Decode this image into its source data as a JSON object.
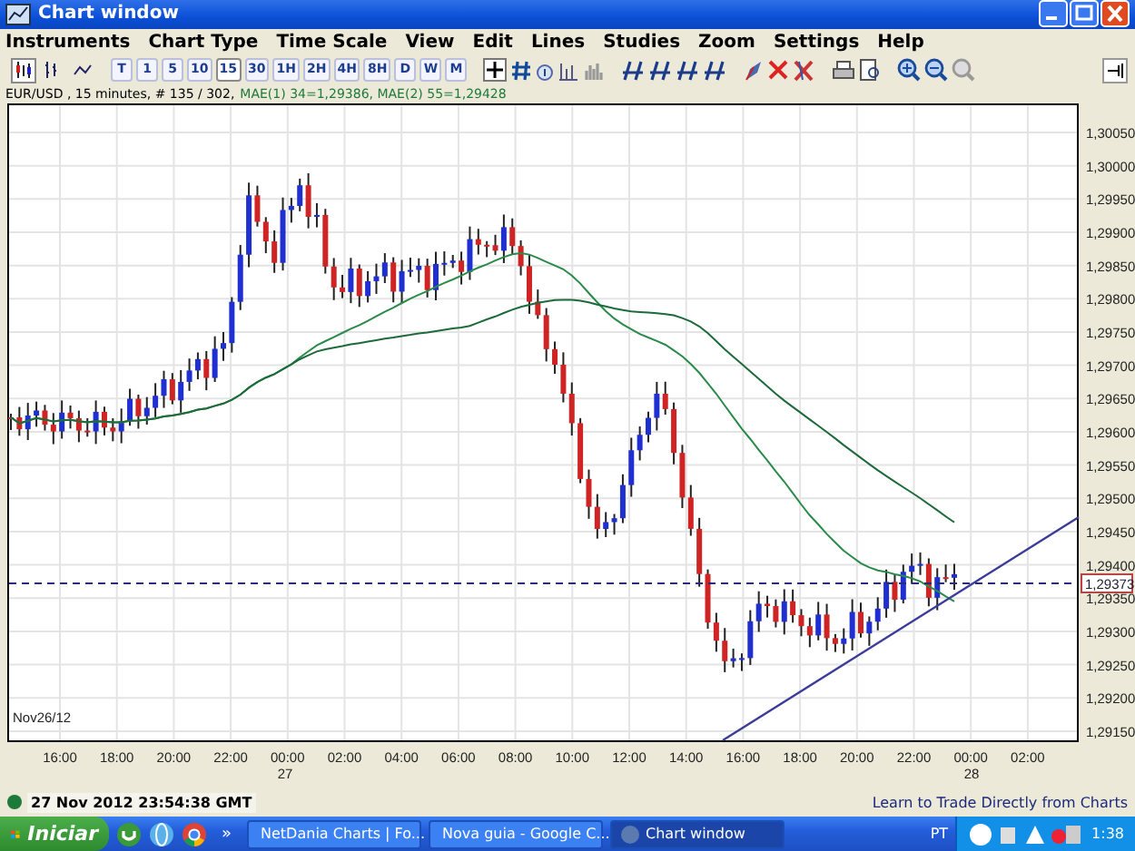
{
  "window": {
    "title": "Chart window"
  },
  "menu": [
    "Instruments",
    "Chart Type",
    "Time Scale",
    "View",
    "Edit",
    "Lines",
    "Studies",
    "Zoom",
    "Settings",
    "Help"
  ],
  "chart_types": [
    {
      "selected": true
    },
    {
      "selected": false
    },
    {
      "selected": false
    }
  ],
  "timeframes": [
    {
      "label": "T",
      "selected": false
    },
    {
      "label": "1",
      "selected": false
    },
    {
      "label": "5",
      "selected": false
    },
    {
      "label": "10",
      "selected": false
    },
    {
      "label": "15",
      "selected": true
    },
    {
      "label": "30",
      "selected": false
    },
    {
      "label": "1H",
      "selected": false
    },
    {
      "label": "2H",
      "selected": false
    },
    {
      "label": "4H",
      "selected": false
    },
    {
      "label": "8H",
      "selected": false
    },
    {
      "label": "D",
      "selected": false
    },
    {
      "label": "W",
      "selected": false
    },
    {
      "label": "M",
      "selected": false
    }
  ],
  "info": {
    "symbol": "EUR/USD , 15 minutes, # 135 / 302,",
    "indicators": "MAE(1) 34=1,29386, MAE(2) 55=1,29428"
  },
  "chart": {
    "y_labels": [
      "1,30050",
      "1,30000",
      "1,29950",
      "1,29900",
      "1,29850",
      "1,29800",
      "1,29750",
      "1,29700",
      "1,29650",
      "1,29600",
      "1,29550",
      "1,29500",
      "1,29450",
      "1,29400",
      "1,29350",
      "1,29300",
      "1,29250",
      "1,29200",
      "1,29150"
    ],
    "x_labels": [
      "16:00",
      "18:00",
      "20:00",
      "22:00",
      "00:00",
      "02:00",
      "04:00",
      "06:00",
      "08:00",
      "10:00",
      "12:00",
      "14:00",
      "16:00",
      "18:00",
      "20:00",
      "22:00",
      "00:00",
      "02:00"
    ],
    "date_labels": [
      "Nov26/12",
      "27",
      "28"
    ],
    "price_marker": "1,29373"
  },
  "status_bar": {
    "connected": true,
    "time": "27 Nov 2012 23:54:38 GMT",
    "link": "Learn to Trade Directly from Charts"
  },
  "taskbar": {
    "start": "Iniciar",
    "more": "»",
    "tasks": [
      {
        "label": "NetDania Charts | Fo...",
        "selected": false
      },
      {
        "label": "Nova guia - Google C...",
        "selected": false
      },
      {
        "label": "Chart window",
        "selected": true
      }
    ],
    "language": "PT",
    "clock": "1:38"
  }
}
